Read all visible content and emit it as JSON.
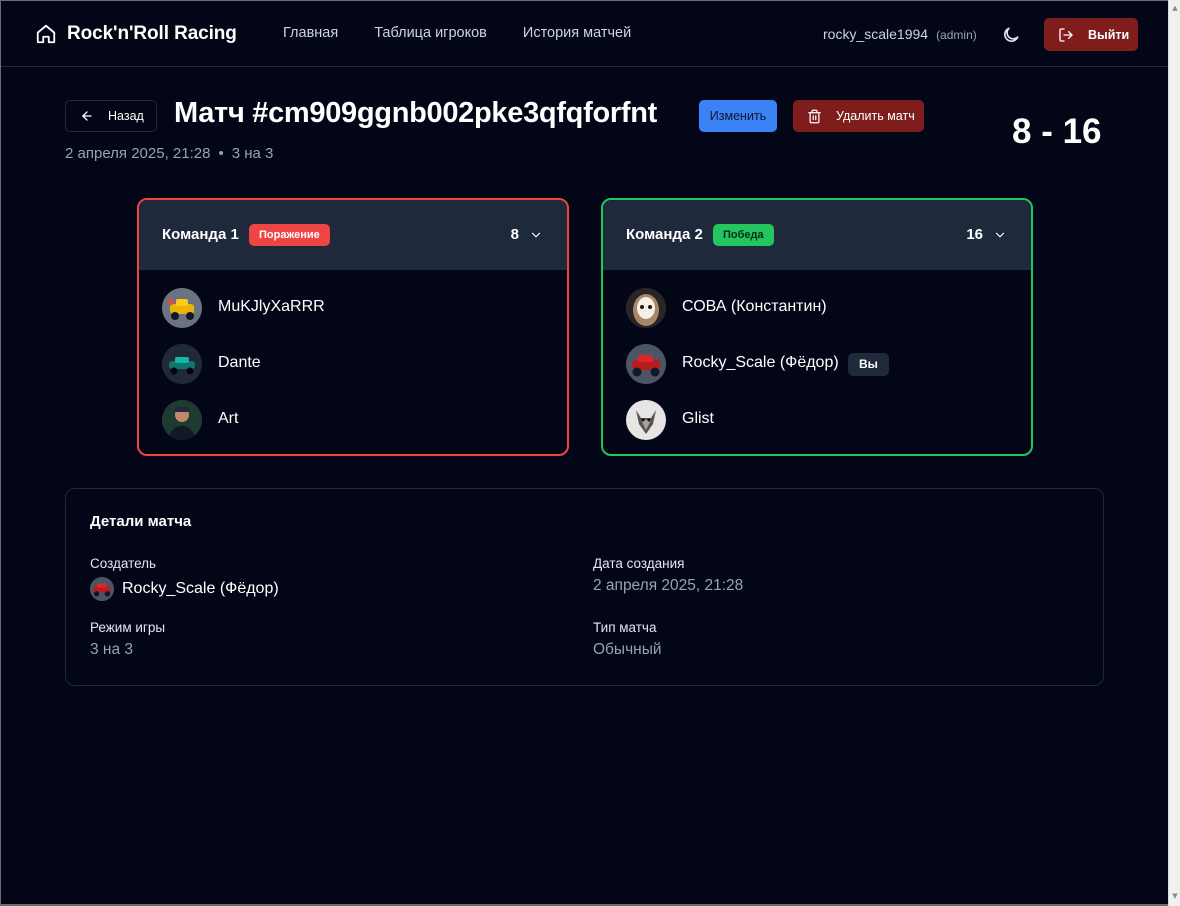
{
  "header": {
    "brand": "Rock'n'Roll Racing",
    "nav": [
      "Главная",
      "Таблица игроков",
      "История матчей"
    ],
    "username": "rocky_scale1994",
    "role": "(admin)",
    "logout_label": "Выйти"
  },
  "match": {
    "back_label": "Назад",
    "title": "Матч #cm909ggnb002pke3qfqforfnt",
    "edit_label": "Изменить",
    "delete_label": "Удалить матч",
    "date": "2 апреля 2025, 21:28",
    "separator": "•",
    "mode": "3 на 3",
    "score": "8 - 16"
  },
  "teams": [
    {
      "name": "Команда 1",
      "result": "Поражение",
      "score": "8",
      "players": [
        {
          "name": "MuKJlyXaRRR"
        },
        {
          "name": "Dante"
        },
        {
          "name": "Art"
        }
      ]
    },
    {
      "name": "Команда 2",
      "result": "Победа",
      "score": "16",
      "players": [
        {
          "name": "СОВА (Константин)"
        },
        {
          "name": "Rocky_Scale (Фёдор)",
          "badge": "Вы"
        },
        {
          "name": "Glist"
        }
      ]
    }
  ],
  "details": {
    "heading": "Детали матча",
    "creator_label": "Создатель",
    "creator_value": "Rocky_Scale (Фёдор)",
    "created_label": "Дата создания",
    "created_value": "2 апреля 2025, 21:28",
    "mode_label": "Режим игры",
    "mode_value": "3 на 3",
    "type_label": "Тип матча",
    "type_value": "Обычный"
  },
  "colors": {
    "background": "#020617",
    "loss": "#ef4444",
    "win": "#22c55e",
    "edit": "#3b82f6",
    "danger": "#7f1d1d",
    "panel": "#1e293b"
  },
  "icons": [
    "home-icon",
    "moon-icon",
    "logout-icon",
    "arrow-left-icon",
    "trash-icon",
    "chevron-down-icon"
  ]
}
